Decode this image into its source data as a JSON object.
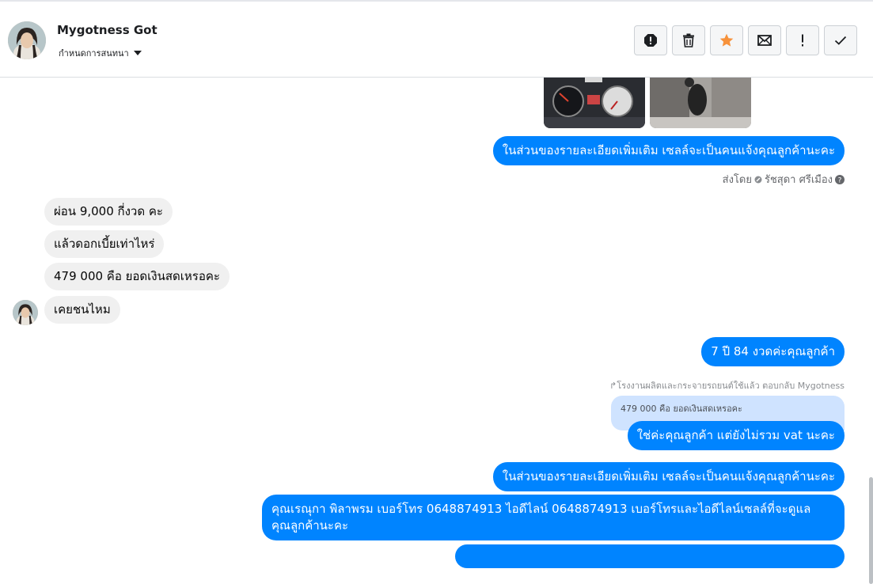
{
  "header": {
    "contact_name": "Mygotness Got",
    "label_dropdown": "กำหนดการสนทนา",
    "actions": [
      {
        "name": "report-spam-button",
        "icon": "alert-octagon-icon"
      },
      {
        "name": "delete-button",
        "icon": "trash-icon"
      },
      {
        "name": "star-button",
        "icon": "star-icon",
        "color": "#f7923b"
      },
      {
        "name": "mark-unread-button",
        "icon": "envelope-icon"
      },
      {
        "name": "follow-up-button",
        "icon": "exclamation-icon"
      },
      {
        "name": "mark-done-button",
        "icon": "check-icon"
      }
    ]
  },
  "messages": {
    "out1": "ในส่วนของรายละเอียดเพิ่มเติม  เซลล์จะเป็นคนแจ้งคุณลูกค้านะคะ",
    "sent_by_label": "ส่งโดย",
    "sent_by_name": "รัชสุดา ศรีเมือง",
    "in1": "ผ่อน 9,000 กี่งวด คะ",
    "in2": "แล้วดอกเบี้ยเท่าไหร่",
    "in3": "479 000 คือ ยอดเงินสดเหรอคะ",
    "in4": "เคยชนไหม",
    "out2": "7 ปี  84 งวดค่ะคุณลูกค้า",
    "reply_note": "โรงงานผลิตและกระจายรถยนต์ใช้แล้ว ตอบกลับ Mygotness",
    "quoted": "479 000 คือ ยอดเงินสดเหรอคะ",
    "out3": "ใช่ค่ะคุณลูกค้า แต่ยังไม่รวม vat  นะคะ",
    "out4": "ในส่วนของรายละเอียดเพิ่มเติม  เซลล์จะเป็นคนแจ้งคุณลูกค้านะคะ",
    "out5_line1": "คุณเรณุกา พิลาพรม       เบอร์โทร 0648874913  ไอดีไลน์ 0648874913   เบอร์โทรและไอดีไลน์เซลล์ที่จะดูแล",
    "out5_line2": "คุณลูกค้านะคะ"
  },
  "colors": {
    "outgoing_bubble": "#0084ff",
    "incoming_bubble": "#f0f0f0",
    "star": "#f7923b"
  }
}
